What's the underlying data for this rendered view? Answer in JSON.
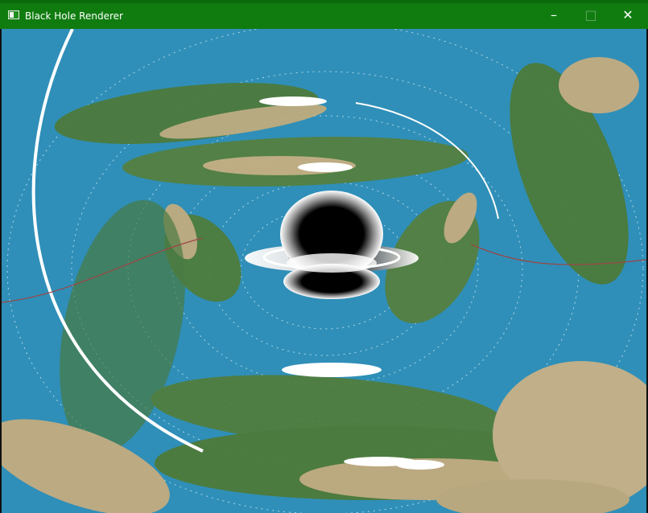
{
  "window": {
    "title": "Black Hole Renderer",
    "controls": {
      "minimize_glyph": "–",
      "maximize_glyph": "□",
      "close_glyph": "✕"
    },
    "app_icon": "window-app-icon"
  },
  "colors": {
    "titlebar": "#107c10",
    "ocean": "#2f8fb8",
    "land_green": "#4f7a35",
    "land_sand": "#c9ad7f",
    "ice": "#ffffff",
    "horizon": "#000000"
  },
  "scene": {
    "description": "gravitationally lensed Earth texture around a black hole with a white-to-black accretion ring",
    "icons": [
      "black-hole-icon",
      "accretion-ring-icon",
      "einstein-ring-icon"
    ]
  }
}
